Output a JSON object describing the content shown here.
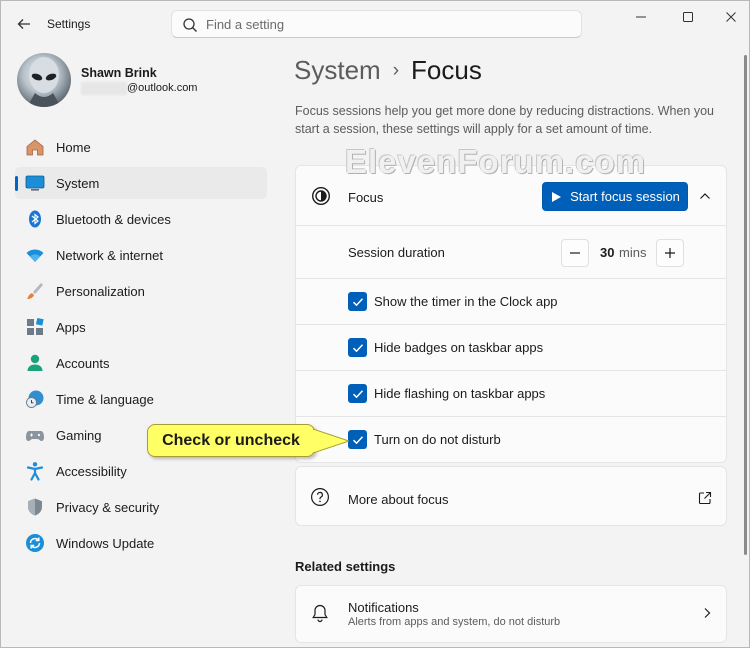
{
  "titlebar": {
    "app_title": "Settings",
    "search_placeholder": "Find a setting"
  },
  "profile": {
    "name": "Shawn Brink",
    "email_suffix": "@outlook.com"
  },
  "sidebar": {
    "items": [
      {
        "label": "Home",
        "icon": "home-icon"
      },
      {
        "label": "System",
        "icon": "system-icon",
        "active": true
      },
      {
        "label": "Bluetooth & devices",
        "icon": "bluetooth-icon"
      },
      {
        "label": "Network & internet",
        "icon": "wifi-icon"
      },
      {
        "label": "Personalization",
        "icon": "brush-icon"
      },
      {
        "label": "Apps",
        "icon": "apps-icon"
      },
      {
        "label": "Accounts",
        "icon": "accounts-icon"
      },
      {
        "label": "Time & language",
        "icon": "clock-globe-icon"
      },
      {
        "label": "Gaming",
        "icon": "gamepad-icon"
      },
      {
        "label": "Accessibility",
        "icon": "accessibility-icon"
      },
      {
        "label": "Privacy & security",
        "icon": "shield-icon"
      },
      {
        "label": "Windows Update",
        "icon": "update-icon"
      }
    ]
  },
  "breadcrumb": {
    "parent": "System",
    "separator": "›",
    "current": "Focus"
  },
  "description": "Focus sessions help you get more done by reducing distractions. When you start a session, these settings will apply for a set amount of time.",
  "watermark": "ElevenForum.com",
  "focus": {
    "label": "Focus",
    "start_button": "Start focus session",
    "duration_label": "Session duration",
    "duration_value": "30",
    "duration_unit": "mins",
    "options": [
      {
        "label": "Show the timer in the Clock app",
        "checked": true
      },
      {
        "label": "Hide badges on taskbar apps",
        "checked": true
      },
      {
        "label": "Hide flashing on taskbar apps",
        "checked": true
      },
      {
        "label": "Turn on do not disturb",
        "checked": true
      }
    ]
  },
  "more": {
    "label": "More about focus"
  },
  "related": {
    "title": "Related settings",
    "notifications_title": "Notifications",
    "notifications_sub": "Alerts from apps and system, do not disturb"
  },
  "callout": {
    "text": "Check or uncheck"
  },
  "colors": {
    "accent": "#005fb8",
    "callout": "#ffff66"
  }
}
